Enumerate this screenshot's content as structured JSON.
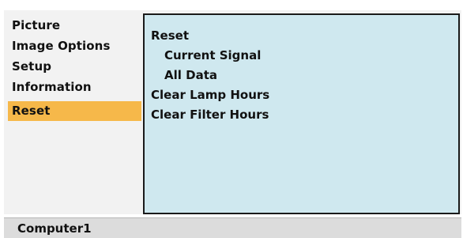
{
  "menu": {
    "items": [
      {
        "label": "Picture",
        "selected": false
      },
      {
        "label": "Image Options",
        "selected": false
      },
      {
        "label": "Setup",
        "selected": false
      },
      {
        "label": "Information",
        "selected": false
      },
      {
        "label": "Reset",
        "selected": true
      }
    ]
  },
  "submenu": {
    "items": [
      {
        "label": "Reset",
        "indent": 0
      },
      {
        "label": "Current Signal",
        "indent": 1
      },
      {
        "label": "All Data",
        "indent": 1
      },
      {
        "label": "Clear Lamp Hours",
        "indent": 0
      },
      {
        "label": "Clear Filter Hours",
        "indent": 0
      }
    ]
  },
  "status": {
    "source": "Computer1"
  },
  "colors": {
    "selected_highlight": "#f6b84a",
    "submenu_background": "#cfe8ef",
    "submenu_border": "#1a1a1a",
    "menu_background": "#f2f2f2",
    "status_background": "#dcdcdc",
    "text": "#111111"
  }
}
